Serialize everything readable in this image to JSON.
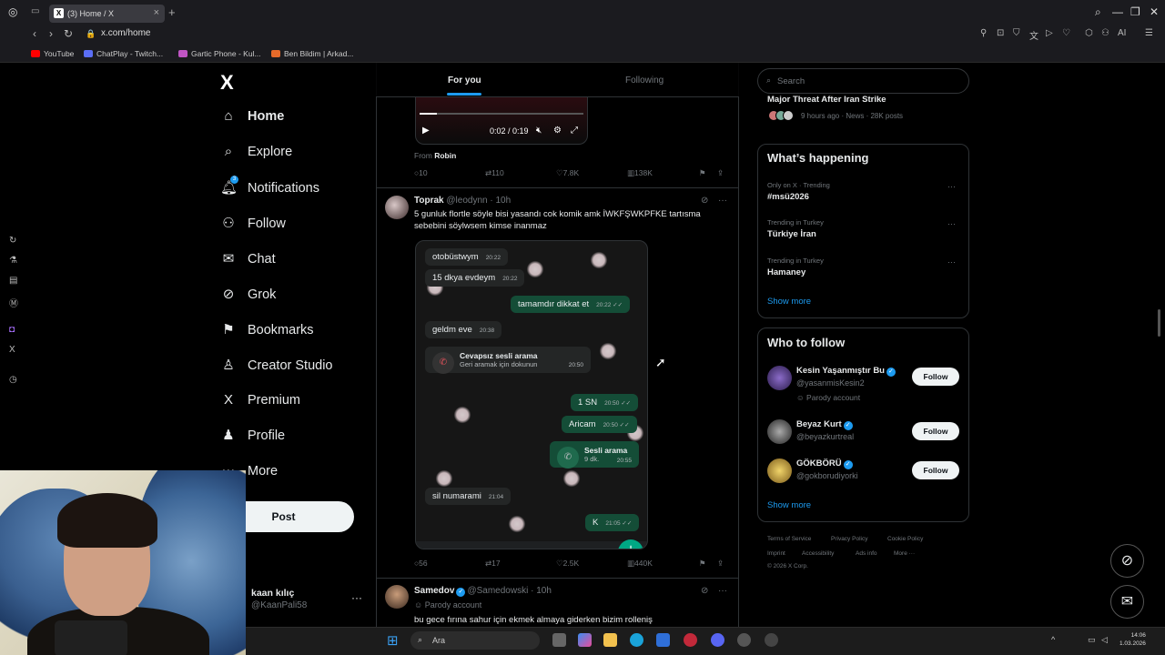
{
  "browser": {
    "tab_title": "(3) Home / X",
    "tab_close": "×",
    "new_tab": "+",
    "url": "x.com/home",
    "bookmarks": [
      "YouTube",
      "ChatPlay - Twitch...",
      "Gartic Phone - Kul...",
      "Ben Bildim | Arkad..."
    ],
    "ai_label": "AI"
  },
  "nav": {
    "logo": "X",
    "items": [
      {
        "label": "Home",
        "icon": "home-icon"
      },
      {
        "label": "Explore",
        "icon": "search-icon"
      },
      {
        "label": "Notifications",
        "icon": "bell-icon",
        "badge": "3"
      },
      {
        "label": "Follow",
        "icon": "person-add-icon"
      },
      {
        "label": "Chat",
        "icon": "mail-icon"
      },
      {
        "label": "Grok",
        "icon": "grok-icon"
      },
      {
        "label": "Bookmarks",
        "icon": "bookmark-icon"
      },
      {
        "label": "Creator Studio",
        "icon": "creator-icon"
      },
      {
        "label": "Premium",
        "icon": "x-icon"
      },
      {
        "label": "Profile",
        "icon": "profile-icon"
      },
      {
        "label": "More",
        "icon": "more-icon"
      }
    ],
    "post_label": "Post",
    "account": {
      "name": "kaan kılıç",
      "handle": "@KaanPali58",
      "more": "···"
    }
  },
  "feed": {
    "tabs": [
      {
        "label": "For you",
        "active": true
      },
      {
        "label": "Following",
        "active": false
      }
    ],
    "video": {
      "time": "0:02 / 0:19",
      "progress": 0.105,
      "from_prefix": "From",
      "from_name": "Robin"
    },
    "post0_actions": {
      "replies": "10",
      "reposts": "110",
      "likes": "7.8K",
      "views": "138K"
    },
    "post1": {
      "name": "Toprak",
      "handle": "@leodynn",
      "time": "· 10h",
      "text": "5 gunluk flortle söyle bisi yasandı cok komik amk İWKFŞWKPFKE tartısma sebebini söylwsem kimse inanmaz",
      "actions": {
        "replies": "56",
        "reposts": "17",
        "likes": "2.5K",
        "views": "440K"
      },
      "chat": [
        {
          "dir": "in",
          "text": "otobüstwym",
          "time": "20:22"
        },
        {
          "dir": "in",
          "text": "15 dkya evdeym",
          "time": "20:22"
        },
        {
          "dir": "out",
          "text": "tamamdır dikkat et",
          "time": "20:22 ✓✓"
        },
        {
          "dir": "in",
          "text": "geldm eve",
          "time": "20:38"
        },
        {
          "dir": "out",
          "text": "1 SN",
          "time": "20:50 ✓✓"
        },
        {
          "dir": "out",
          "text": "Aricam",
          "time": "20:50 ✓✓"
        },
        {
          "dir": "in",
          "text": "sil numarami",
          "time": "21:04"
        },
        {
          "dir": "out",
          "text": "K",
          "time": "21:05 ✓✓"
        }
      ],
      "missed_call": {
        "title": "Cevapsız sesli arama",
        "sub": "Geri aramak için dokunun",
        "time": "20:50"
      },
      "voice_call": {
        "title": "Sesli arama",
        "sub": "9 dk.",
        "time": "20:55"
      }
    },
    "post2": {
      "name": "Samedov",
      "handle": "@Samedowski",
      "time": "· 10h",
      "sub": "Parody account",
      "text": "bu gece fırına sahur için ekmek almaya giderken bizim rolleniş"
    }
  },
  "right": {
    "search_placeholder": "Search",
    "top_trend": {
      "title": "Major Threat After Iran Strike",
      "meta": "9 hours ago · News · 28K posts"
    },
    "happening_title": "What’s happening",
    "trends": [
      {
        "meta": "Only on X · Trending",
        "name": "#msü2026"
      },
      {
        "meta": "Trending in Turkey",
        "name": "Türkiye İran"
      },
      {
        "meta": "Trending in Turkey",
        "name": "Hamaney"
      }
    ],
    "show_more": "Show more",
    "who_title": "Who to follow",
    "who": [
      {
        "name": "Kesin Yaşanmıştır Bu",
        "handle": "@yasanmisKesin2",
        "sub": "Parody account",
        "button": "Follow"
      },
      {
        "name": "Beyaz Kurt",
        "handle": "@beyazkurtreal",
        "button": "Follow"
      },
      {
        "name": "GÖKBÖRÜ",
        "handle": "@gokborudiyorki",
        "button": "Follow"
      }
    ],
    "footer": [
      "Terms of Service",
      "Privacy Policy",
      "Cookie Policy",
      "Imprint",
      "Accessibility",
      "Ads info",
      "More ···",
      "© 2026 X Corp."
    ]
  },
  "taskbar": {
    "search": "Ara",
    "time": "14:06",
    "date": "1.03.2026"
  },
  "colors": {
    "accent": "#1d9bf0",
    "bg": "#000000",
    "border": "#2f3336"
  }
}
